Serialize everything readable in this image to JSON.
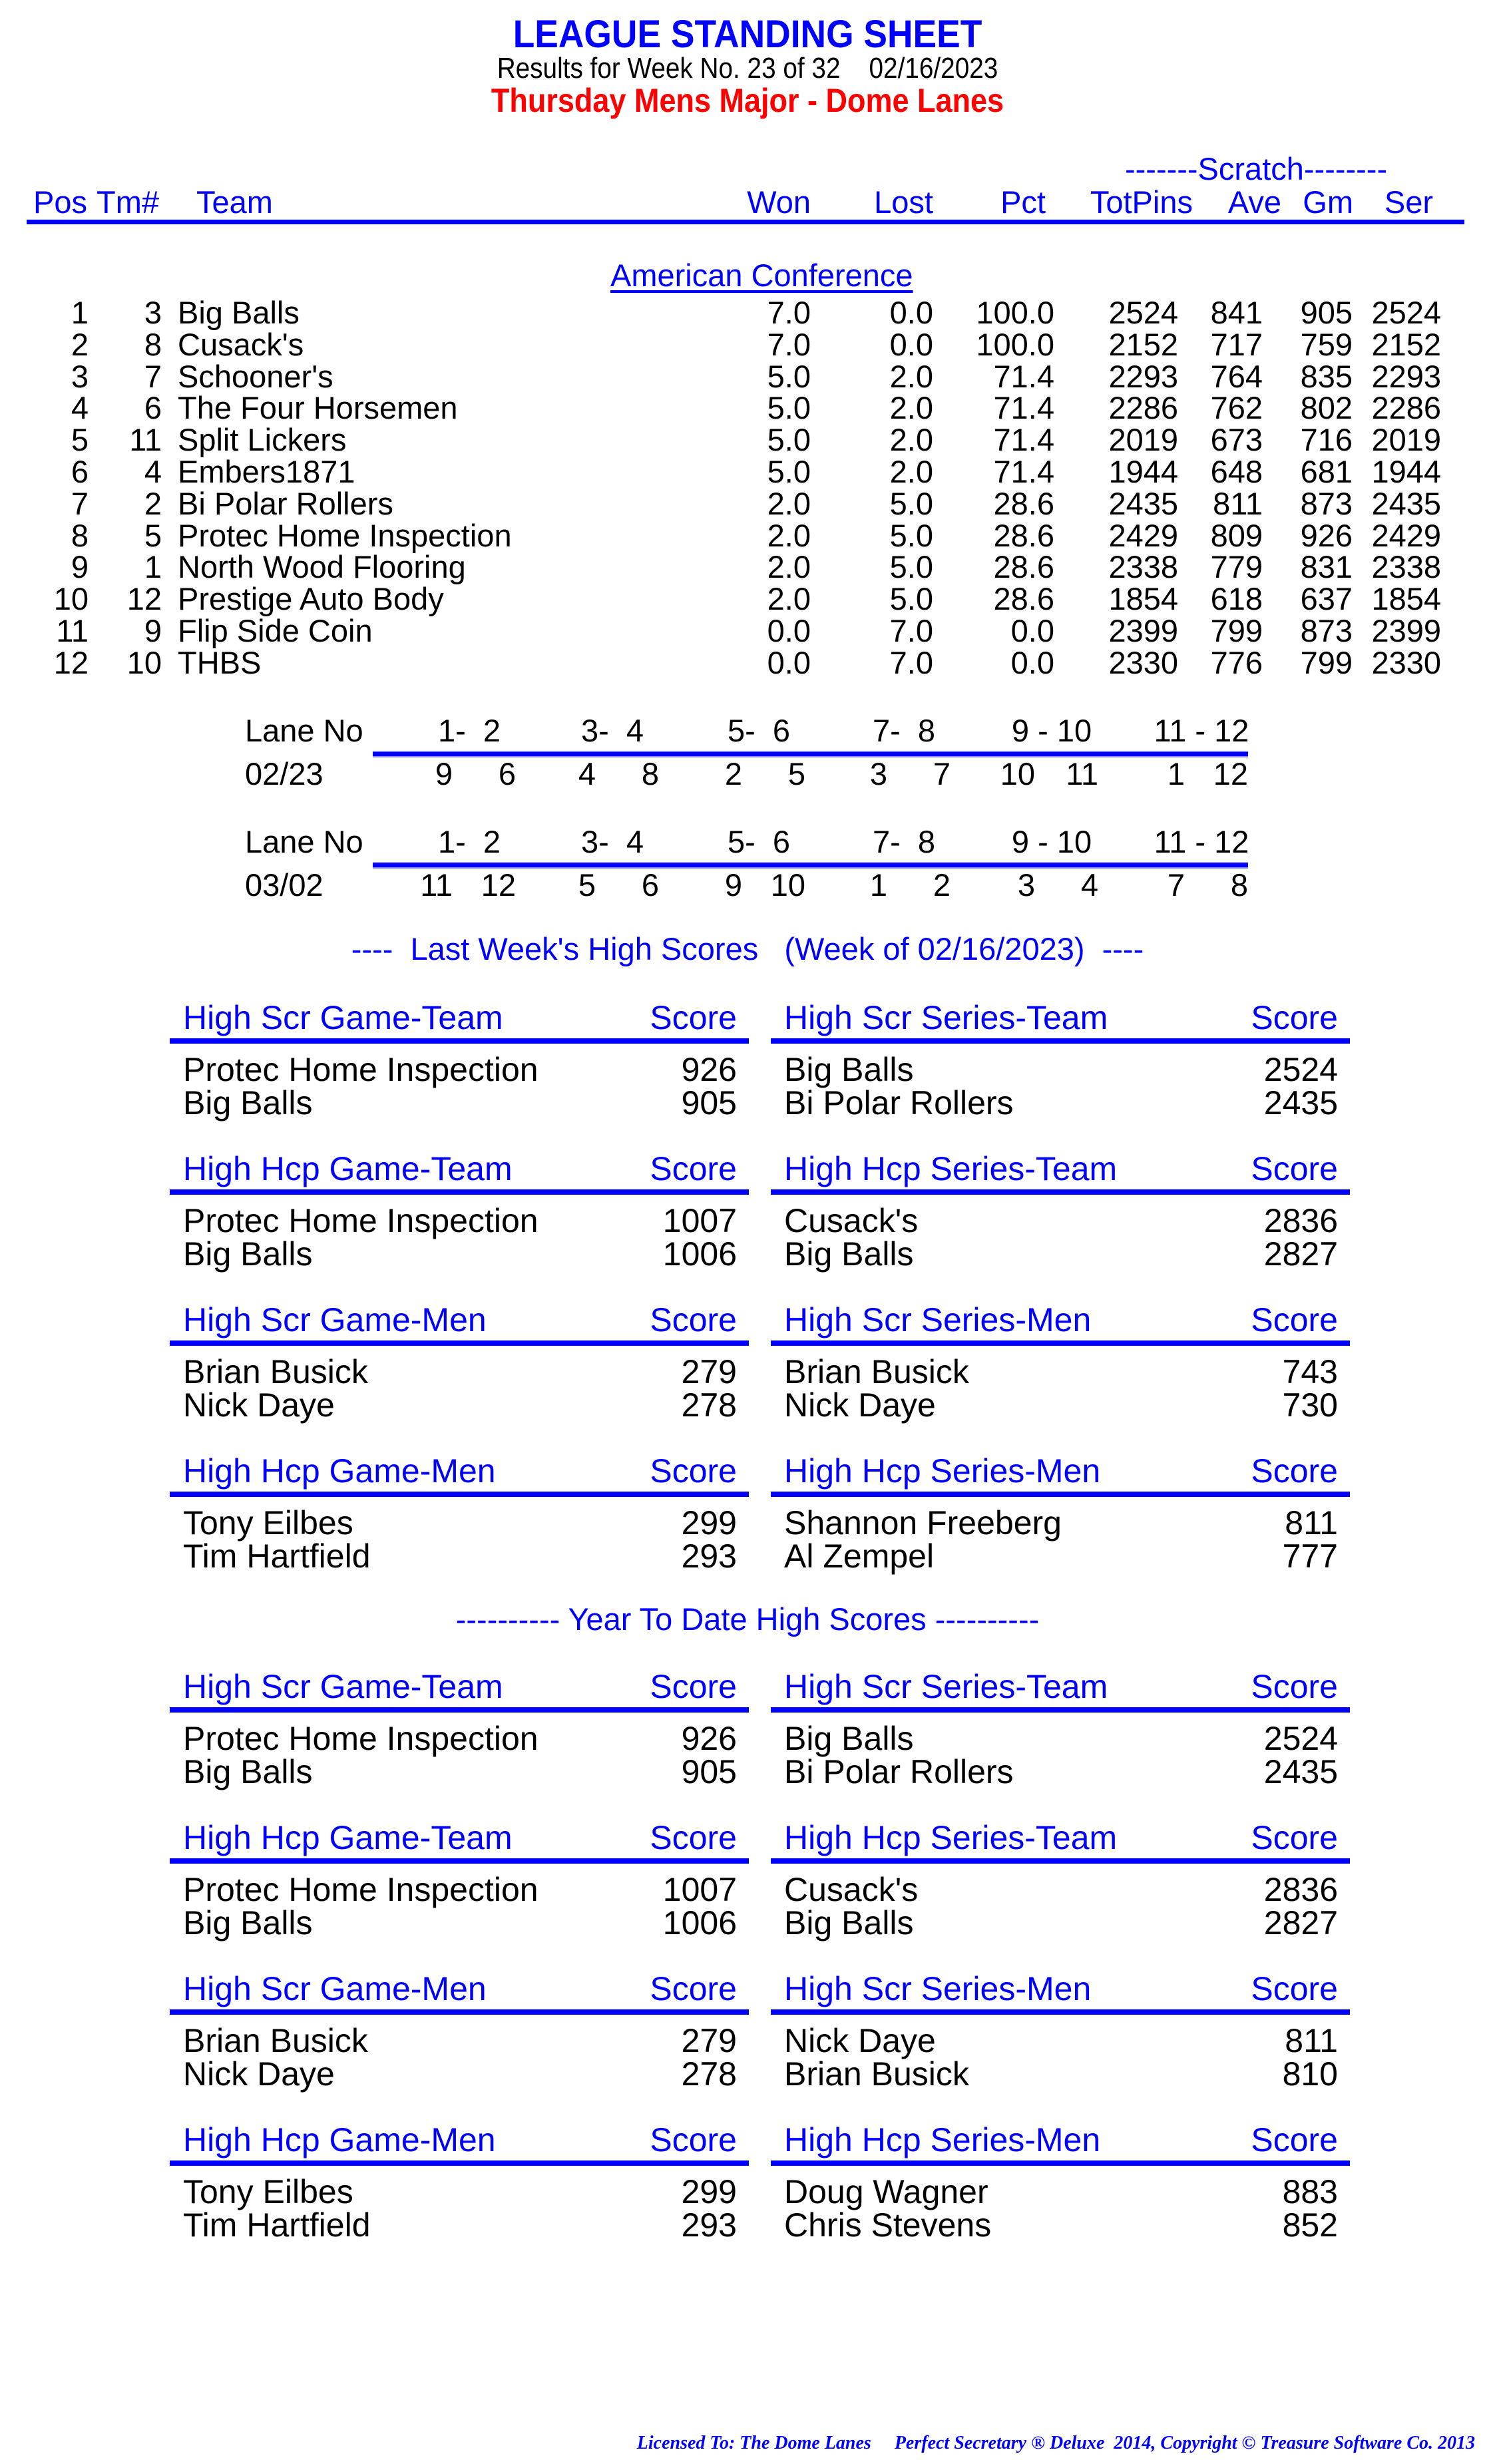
{
  "header": {
    "title": "LEAGUE STANDING SHEET",
    "subtitle": "Results for Week No. 23 of 32    02/16/2023",
    "league_name": "Thursday Mens Major - Dome Lanes"
  },
  "standings": {
    "group_label": "-------Scratch--------",
    "columns": [
      "Pos",
      "Tm#",
      "Team",
      "Won",
      "Lost",
      "Pct",
      "TotPins",
      "Ave",
      "Gm",
      "Ser"
    ],
    "conference": "American Conference",
    "rows": [
      {
        "pos": "1",
        "tm": "3",
        "team": "Big Balls",
        "won": "7.0",
        "lost": "0.0",
        "pct": "100.0",
        "totpins": "2524",
        "ave": "841",
        "gm": "905",
        "ser": "2524"
      },
      {
        "pos": "2",
        "tm": "8",
        "team": "Cusack's",
        "won": "7.0",
        "lost": "0.0",
        "pct": "100.0",
        "totpins": "2152",
        "ave": "717",
        "gm": "759",
        "ser": "2152"
      },
      {
        "pos": "3",
        "tm": "7",
        "team": "Schooner's",
        "won": "5.0",
        "lost": "2.0",
        "pct": "71.4",
        "totpins": "2293",
        "ave": "764",
        "gm": "835",
        "ser": "2293"
      },
      {
        "pos": "4",
        "tm": "6",
        "team": "The Four Horsemen",
        "won": "5.0",
        "lost": "2.0",
        "pct": "71.4",
        "totpins": "2286",
        "ave": "762",
        "gm": "802",
        "ser": "2286"
      },
      {
        "pos": "5",
        "tm": "11",
        "team": "Split Lickers",
        "won": "5.0",
        "lost": "2.0",
        "pct": "71.4",
        "totpins": "2019",
        "ave": "673",
        "gm": "716",
        "ser": "2019"
      },
      {
        "pos": "6",
        "tm": "4",
        "team": "Embers1871",
        "won": "5.0",
        "lost": "2.0",
        "pct": "71.4",
        "totpins": "1944",
        "ave": "648",
        "gm": "681",
        "ser": "1944"
      },
      {
        "pos": "7",
        "tm": "2",
        "team": "Bi Polar Rollers",
        "won": "2.0",
        "lost": "5.0",
        "pct": "28.6",
        "totpins": "2435",
        "ave": "811",
        "gm": "873",
        "ser": "2435"
      },
      {
        "pos": "8",
        "tm": "5",
        "team": "Protec Home Inspection",
        "won": "2.0",
        "lost": "5.0",
        "pct": "28.6",
        "totpins": "2429",
        "ave": "809",
        "gm": "926",
        "ser": "2429"
      },
      {
        "pos": "9",
        "tm": "1",
        "team": "North Wood Flooring",
        "won": "2.0",
        "lost": "5.0",
        "pct": "28.6",
        "totpins": "2338",
        "ave": "779",
        "gm": "831",
        "ser": "2338"
      },
      {
        "pos": "10",
        "tm": "12",
        "team": "Prestige Auto Body",
        "won": "2.0",
        "lost": "5.0",
        "pct": "28.6",
        "totpins": "1854",
        "ave": "618",
        "gm": "637",
        "ser": "1854"
      },
      {
        "pos": "11",
        "tm": "9",
        "team": "Flip Side Coin",
        "won": "0.0",
        "lost": "7.0",
        "pct": "0.0",
        "totpins": "2399",
        "ave": "799",
        "gm": "873",
        "ser": "2399"
      },
      {
        "pos": "12",
        "tm": "10",
        "team": "THBS",
        "won": "0.0",
        "lost": "7.0",
        "pct": "0.0",
        "totpins": "2330",
        "ave": "776",
        "gm": "799",
        "ser": "2330"
      }
    ]
  },
  "lane_assignments": [
    {
      "label": "Lane No",
      "lanes": [
        "1-  2",
        "3-  4",
        "5-  6",
        "7-  8",
        "9 - 10",
        "11 - 12"
      ],
      "date": "02/23",
      "pairs": [
        [
          "9",
          "6"
        ],
        [
          "4",
          "8"
        ],
        [
          "2",
          "5"
        ],
        [
          "3",
          "7"
        ],
        [
          "10",
          "11"
        ],
        [
          "1",
          "12"
        ]
      ]
    },
    {
      "label": "Lane No",
      "lanes": [
        "1-  2",
        "3-  4",
        "5-  6",
        "7-  8",
        "9 - 10",
        "11 - 12"
      ],
      "date": "03/02",
      "pairs": [
        [
          "11",
          "12"
        ],
        [
          "5",
          "6"
        ],
        [
          "9",
          "10"
        ],
        [
          "1",
          "2"
        ],
        [
          "3",
          "4"
        ],
        [
          "7",
          "8"
        ]
      ]
    }
  ],
  "last_week": {
    "title": "----  Last Week's High Scores   (Week of 02/16/2023)  ----",
    "blocks": [
      {
        "title": "High Scr Game-Team",
        "score_label": "Score",
        "rows": [
          {
            "name": "Protec Home Inspection",
            "score": "926"
          },
          {
            "name": "Big Balls",
            "score": "905"
          }
        ]
      },
      {
        "title": "High Scr Series-Team",
        "score_label": "Score",
        "rows": [
          {
            "name": "Big Balls",
            "score": "2524"
          },
          {
            "name": "Bi Polar Rollers",
            "score": "2435"
          }
        ]
      },
      {
        "title": "High Hcp Game-Team",
        "score_label": "Score",
        "rows": [
          {
            "name": "Protec Home Inspection",
            "score": "1007"
          },
          {
            "name": "Big Balls",
            "score": "1006"
          }
        ]
      },
      {
        "title": "High Hcp Series-Team",
        "score_label": "Score",
        "rows": [
          {
            "name": "Cusack's",
            "score": "2836"
          },
          {
            "name": "Big Balls",
            "score": "2827"
          }
        ]
      },
      {
        "title": "High Scr Game-Men",
        "score_label": "Score",
        "rows": [
          {
            "name": "Brian Busick",
            "score": "279"
          },
          {
            "name": "Nick Daye",
            "score": "278"
          }
        ]
      },
      {
        "title": "High Scr Series-Men",
        "score_label": "Score",
        "rows": [
          {
            "name": "Brian Busick",
            "score": "743"
          },
          {
            "name": "Nick Daye",
            "score": "730"
          }
        ]
      },
      {
        "title": "High Hcp Game-Men",
        "score_label": "Score",
        "rows": [
          {
            "name": "Tony Eilbes",
            "score": "299"
          },
          {
            "name": "Tim Hartfield",
            "score": "293"
          }
        ]
      },
      {
        "title": "High Hcp Series-Men",
        "score_label": "Score",
        "rows": [
          {
            "name": "Shannon Freeberg",
            "score": "811"
          },
          {
            "name": "Al Zempel",
            "score": "777"
          }
        ]
      }
    ]
  },
  "year_to_date": {
    "title": "---------- Year To Date High Scores ----------",
    "blocks": [
      {
        "title": "High Scr Game-Team",
        "score_label": "Score",
        "rows": [
          {
            "name": "Protec Home Inspection",
            "score": "926"
          },
          {
            "name": "Big Balls",
            "score": "905"
          }
        ]
      },
      {
        "title": "High Scr Series-Team",
        "score_label": "Score",
        "rows": [
          {
            "name": "Big Balls",
            "score": "2524"
          },
          {
            "name": "Bi Polar Rollers",
            "score": "2435"
          }
        ]
      },
      {
        "title": "High Hcp Game-Team",
        "score_label": "Score",
        "rows": [
          {
            "name": "Protec Home Inspection",
            "score": "1007"
          },
          {
            "name": "Big Balls",
            "score": "1006"
          }
        ]
      },
      {
        "title": "High Hcp Series-Team",
        "score_label": "Score",
        "rows": [
          {
            "name": "Cusack's",
            "score": "2836"
          },
          {
            "name": "Big Balls",
            "score": "2827"
          }
        ]
      },
      {
        "title": "High Scr Game-Men",
        "score_label": "Score",
        "rows": [
          {
            "name": "Brian Busick",
            "score": "279"
          },
          {
            "name": "Nick Daye",
            "score": "278"
          }
        ]
      },
      {
        "title": "High Scr Series-Men",
        "score_label": "Score",
        "rows": [
          {
            "name": "Nick Daye",
            "score": "811"
          },
          {
            "name": "Brian Busick",
            "score": "810"
          }
        ]
      },
      {
        "title": "High Hcp Game-Men",
        "score_label": "Score",
        "rows": [
          {
            "name": "Tony Eilbes",
            "score": "299"
          },
          {
            "name": "Tim Hartfield",
            "score": "293"
          }
        ]
      },
      {
        "title": "High Hcp Series-Men",
        "score_label": "Score",
        "rows": [
          {
            "name": "Doug Wagner",
            "score": "883"
          },
          {
            "name": "Chris Stevens",
            "score": "852"
          }
        ]
      }
    ]
  },
  "footer": {
    "text": "Licensed To: The Dome Lanes     Perfect Secretary ® Deluxe  2014, Copyright © Treasure Software Co. 2013"
  },
  "colors": {
    "heading_blue": "#0000ff",
    "league_red": "#ff0000",
    "body_text": "#000000"
  }
}
